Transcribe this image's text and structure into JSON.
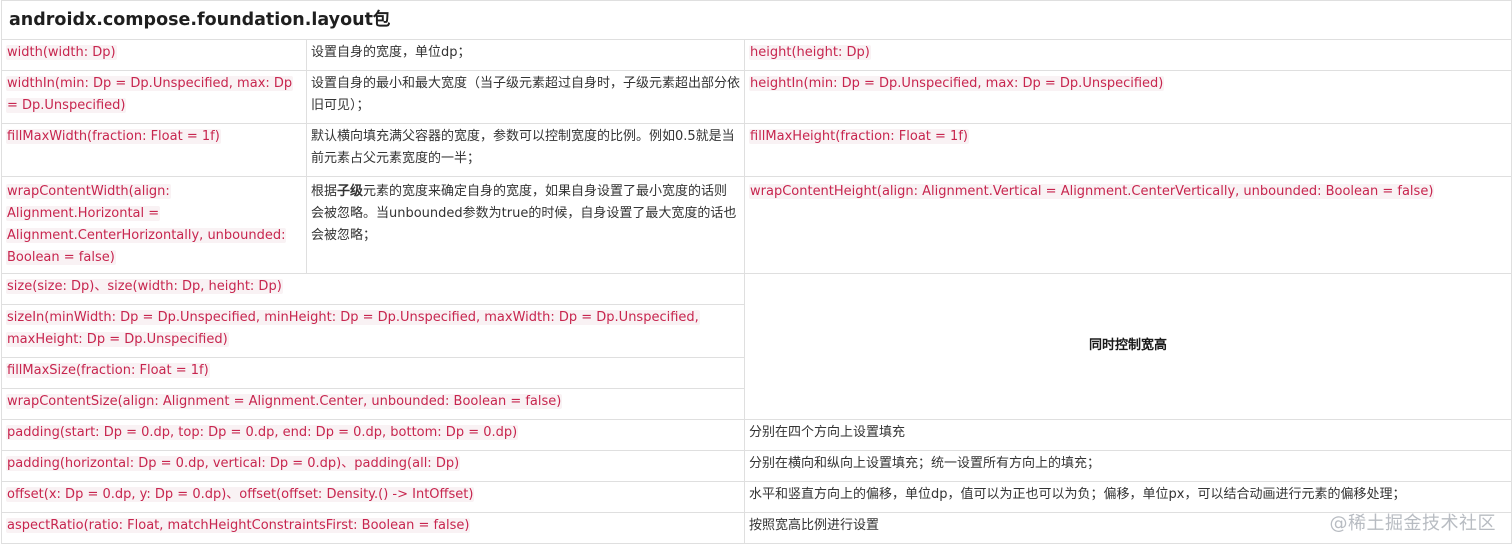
{
  "title": "androidx.compose.foundation.layout包",
  "rows": [
    {
      "code": "width(width: Dp)",
      "desc": "设置自身的宽度，单位dp；",
      "code2": "height(height: Dp)"
    },
    {
      "code": "widthIn(min: Dp = Dp.Unspecified, max: Dp = Dp.Unspecified)",
      "desc": "设置自身的最小和最大宽度（当子级元素超过自身时，子级元素超出部分依旧可见）；",
      "code2": "heightIn(min: Dp = Dp.Unspecified, max: Dp = Dp.Unspecified)"
    },
    {
      "code": "fillMaxWidth(fraction: Float = 1f)",
      "desc": "默认横向填充满父容器的宽度，参数可以控制宽度的比例。例如0.5就是当前元素占父元素宽度的一半；",
      "code2": "fillMaxHeight(fraction: Float = 1f)"
    },
    {
      "code": "wrapContentWidth(align: Alignment.Horizontal = Alignment.CenterHorizontally, unbounded: Boolean = false)",
      "desc_parts": [
        "根据",
        "子级",
        "元素的宽度来确定自身的宽度，如果自身设置了最小宽度的话则会被忽略。当unbounded参数为true的时候，自身设置了最大宽度的话也会被忽略；"
      ],
      "code2": "wrapContentHeight(align: Alignment.Vertical = Alignment.CenterVertically, unbounded: Boolean = false)"
    }
  ],
  "size_group": {
    "items": [
      "size(size: Dp)、size(width: Dp, height: Dp)",
      "sizeIn(minWidth: Dp = Dp.Unspecified, minHeight: Dp = Dp.Unspecified, maxWidth: Dp = Dp.Unspecified, maxHeight: Dp = Dp.Unspecified)",
      "fillMaxSize(fraction: Float = 1f)",
      "wrapContentSize(align: Alignment = Alignment.Center, unbounded: Boolean = false)"
    ],
    "desc": "同时控制宽高"
  },
  "bottom_rows": [
    {
      "code": "padding(start: Dp = 0.dp, top: Dp = 0.dp, end: Dp = 0.dp, bottom: Dp = 0.dp)",
      "desc": "分别在四个方向上设置填充"
    },
    {
      "code": "padding(horizontal: Dp = 0.dp, vertical: Dp = 0.dp)、padding(all: Dp)",
      "desc": "分别在横向和纵向上设置填充；统一设置所有方向上的填充；"
    },
    {
      "code": "offset(x: Dp = 0.dp, y: Dp = 0.dp)、offset(offset: Density.() -> IntOffset)",
      "desc": "水平和竖直方向上的偏移，单位dp，值可以为正也可以为负；偏移，单位px，可以结合动画进行元素的偏移处理；"
    },
    {
      "code": "aspectRatio(ratio: Float, matchHeightConstraintsFirst: Boolean = false)",
      "desc": "按照宽高比例进行设置"
    }
  ],
  "watermark": "@稀土掘金技术社区"
}
